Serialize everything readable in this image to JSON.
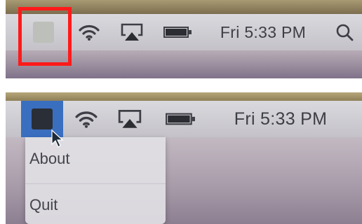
{
  "screens": [
    {
      "menubar": {
        "status_items": [
          "app-icon",
          "wifi-icon",
          "airplay-icon",
          "battery-icon"
        ],
        "clock": "Fri 5:33 PM",
        "spotlight_icon": "search-icon"
      },
      "highlight_color": "#ff1a1a"
    },
    {
      "menubar": {
        "status_items": [
          "app-icon",
          "wifi-icon",
          "airplay-icon",
          "battery-icon"
        ],
        "clock": "Fri 5:33 PM"
      },
      "app_menu": {
        "items": [
          {
            "label": "About"
          },
          {
            "label": "Quit"
          }
        ]
      }
    }
  ]
}
